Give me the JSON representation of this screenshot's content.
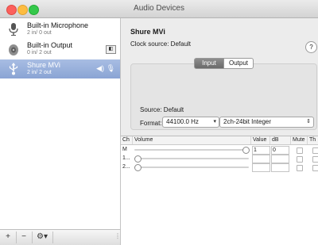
{
  "window": {
    "title": "Audio Devices"
  },
  "sidebar": {
    "devices": [
      {
        "name": "Built-in Microphone",
        "io": "2 in/ 0 out",
        "icon": "microphone-icon"
      },
      {
        "name": "Built-in Output",
        "io": "0 in/ 2 out",
        "icon": "speaker-icon"
      },
      {
        "name": "Shure MVi",
        "io": "2 in/ 2 out",
        "icon": "usb-icon",
        "selected": true
      }
    ],
    "footer": {
      "add": "+",
      "remove": "−",
      "gear": "⚙▾"
    }
  },
  "detail": {
    "device_title": "Shure MVi",
    "clock_source": "Clock source: Default",
    "help": "?",
    "tabs": [
      {
        "label": "Input",
        "selected": true
      },
      {
        "label": "Output",
        "selected": false
      }
    ],
    "source": "Source: Default",
    "format_label": "Format:",
    "sample_rate": "44100.0 Hz",
    "bit_format": "2ch-24bit Integer"
  },
  "channel_table": {
    "headers": [
      "Ch",
      "Volume",
      "Value",
      "dB",
      "Mute",
      "Th"
    ],
    "rows": [
      {
        "ch": "M",
        "volume": 1.0,
        "value": "1",
        "db": "0"
      },
      {
        "ch": "1...",
        "volume": 0.0,
        "value": "",
        "db": ""
      },
      {
        "ch": "2...",
        "volume": 0.0,
        "value": "",
        "db": ""
      }
    ]
  },
  "colors": {
    "selection": "#8aa4d4",
    "close": "#fc605c",
    "minimize": "#fdbc40",
    "zoom": "#34c84a"
  }
}
